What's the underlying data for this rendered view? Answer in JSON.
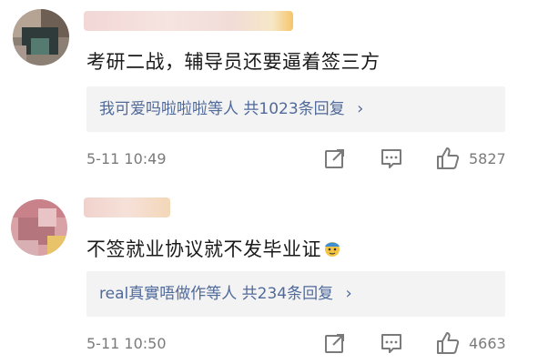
{
  "comments": [
    {
      "text": "考研二战，辅导员还要逼着签三方",
      "reply_users": "我可爱吗啦啦啦等人",
      "reply_count_text": "共1023条回复",
      "reply_chevron": "›",
      "timestamp": "5-11 10:49",
      "likes": "5827",
      "icons": [
        "share-icon",
        "comment-icon",
        "like-icon"
      ]
    },
    {
      "text": "不签就业协议就不发毕业证",
      "emoji": "emoji-icon",
      "reply_users": "real真實唔做作等人",
      "reply_count_text": "共234条回复",
      "reply_chevron": "›",
      "timestamp": "5-11 10:50",
      "likes": "4663",
      "icons": [
        "share-icon",
        "comment-icon",
        "like-icon"
      ]
    }
  ],
  "colors": {
    "link": "#506a9b",
    "meta": "#7a7a7a",
    "reply_bg": "#f3f3f3"
  }
}
